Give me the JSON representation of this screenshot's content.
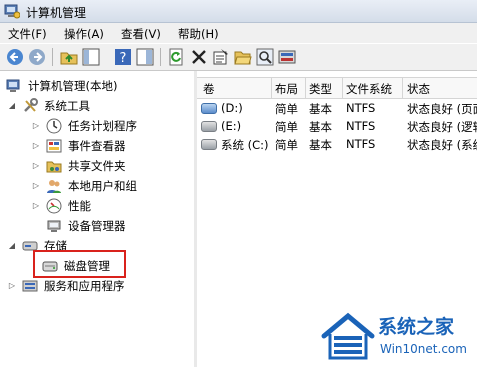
{
  "window": {
    "title": "计算机管理"
  },
  "menu": [
    "文件(F)",
    "操作(A)",
    "查看(V)",
    "帮助(H)"
  ],
  "toolbar": {
    "icons": [
      "back-arrow-icon",
      "forward-arrow-icon",
      "up-folder-icon",
      "show-hide-tree-icon",
      "help-icon",
      "details-pane-icon",
      "refresh-icon",
      "delete-icon",
      "properties-icon",
      "open-folder-icon",
      "search-icon",
      "disk-settings-icon"
    ]
  },
  "tree": {
    "root": "计算机管理(本地)",
    "system_tools": "系统工具",
    "task_scheduler": "任务计划程序",
    "event_viewer": "事件查看器",
    "shared_folders": "共享文件夹",
    "local_users": "本地用户和组",
    "performance": "性能",
    "device_manager": "设备管理器",
    "storage": "存储",
    "disk_management": "磁盘管理",
    "services": "服务和应用程序"
  },
  "table": {
    "headers": [
      "卷",
      "布局",
      "类型",
      "文件系统",
      "状态"
    ],
    "rows": [
      [
        "(D:)",
        "简单",
        "基本",
        "NTFS",
        "状态良好 (页面"
      ],
      [
        "(E:)",
        "简单",
        "基本",
        "NTFS",
        "状态良好 (逻辑"
      ],
      [
        "系统 (C:)",
        "简单",
        "基本",
        "NTFS",
        "状态良好 (系统"
      ]
    ]
  },
  "watermark": {
    "brand": "系统之家",
    "site": "Win10net.com"
  },
  "colors": {
    "highlight_box": "#d9221c",
    "brand_blue": "#1a63b8"
  }
}
